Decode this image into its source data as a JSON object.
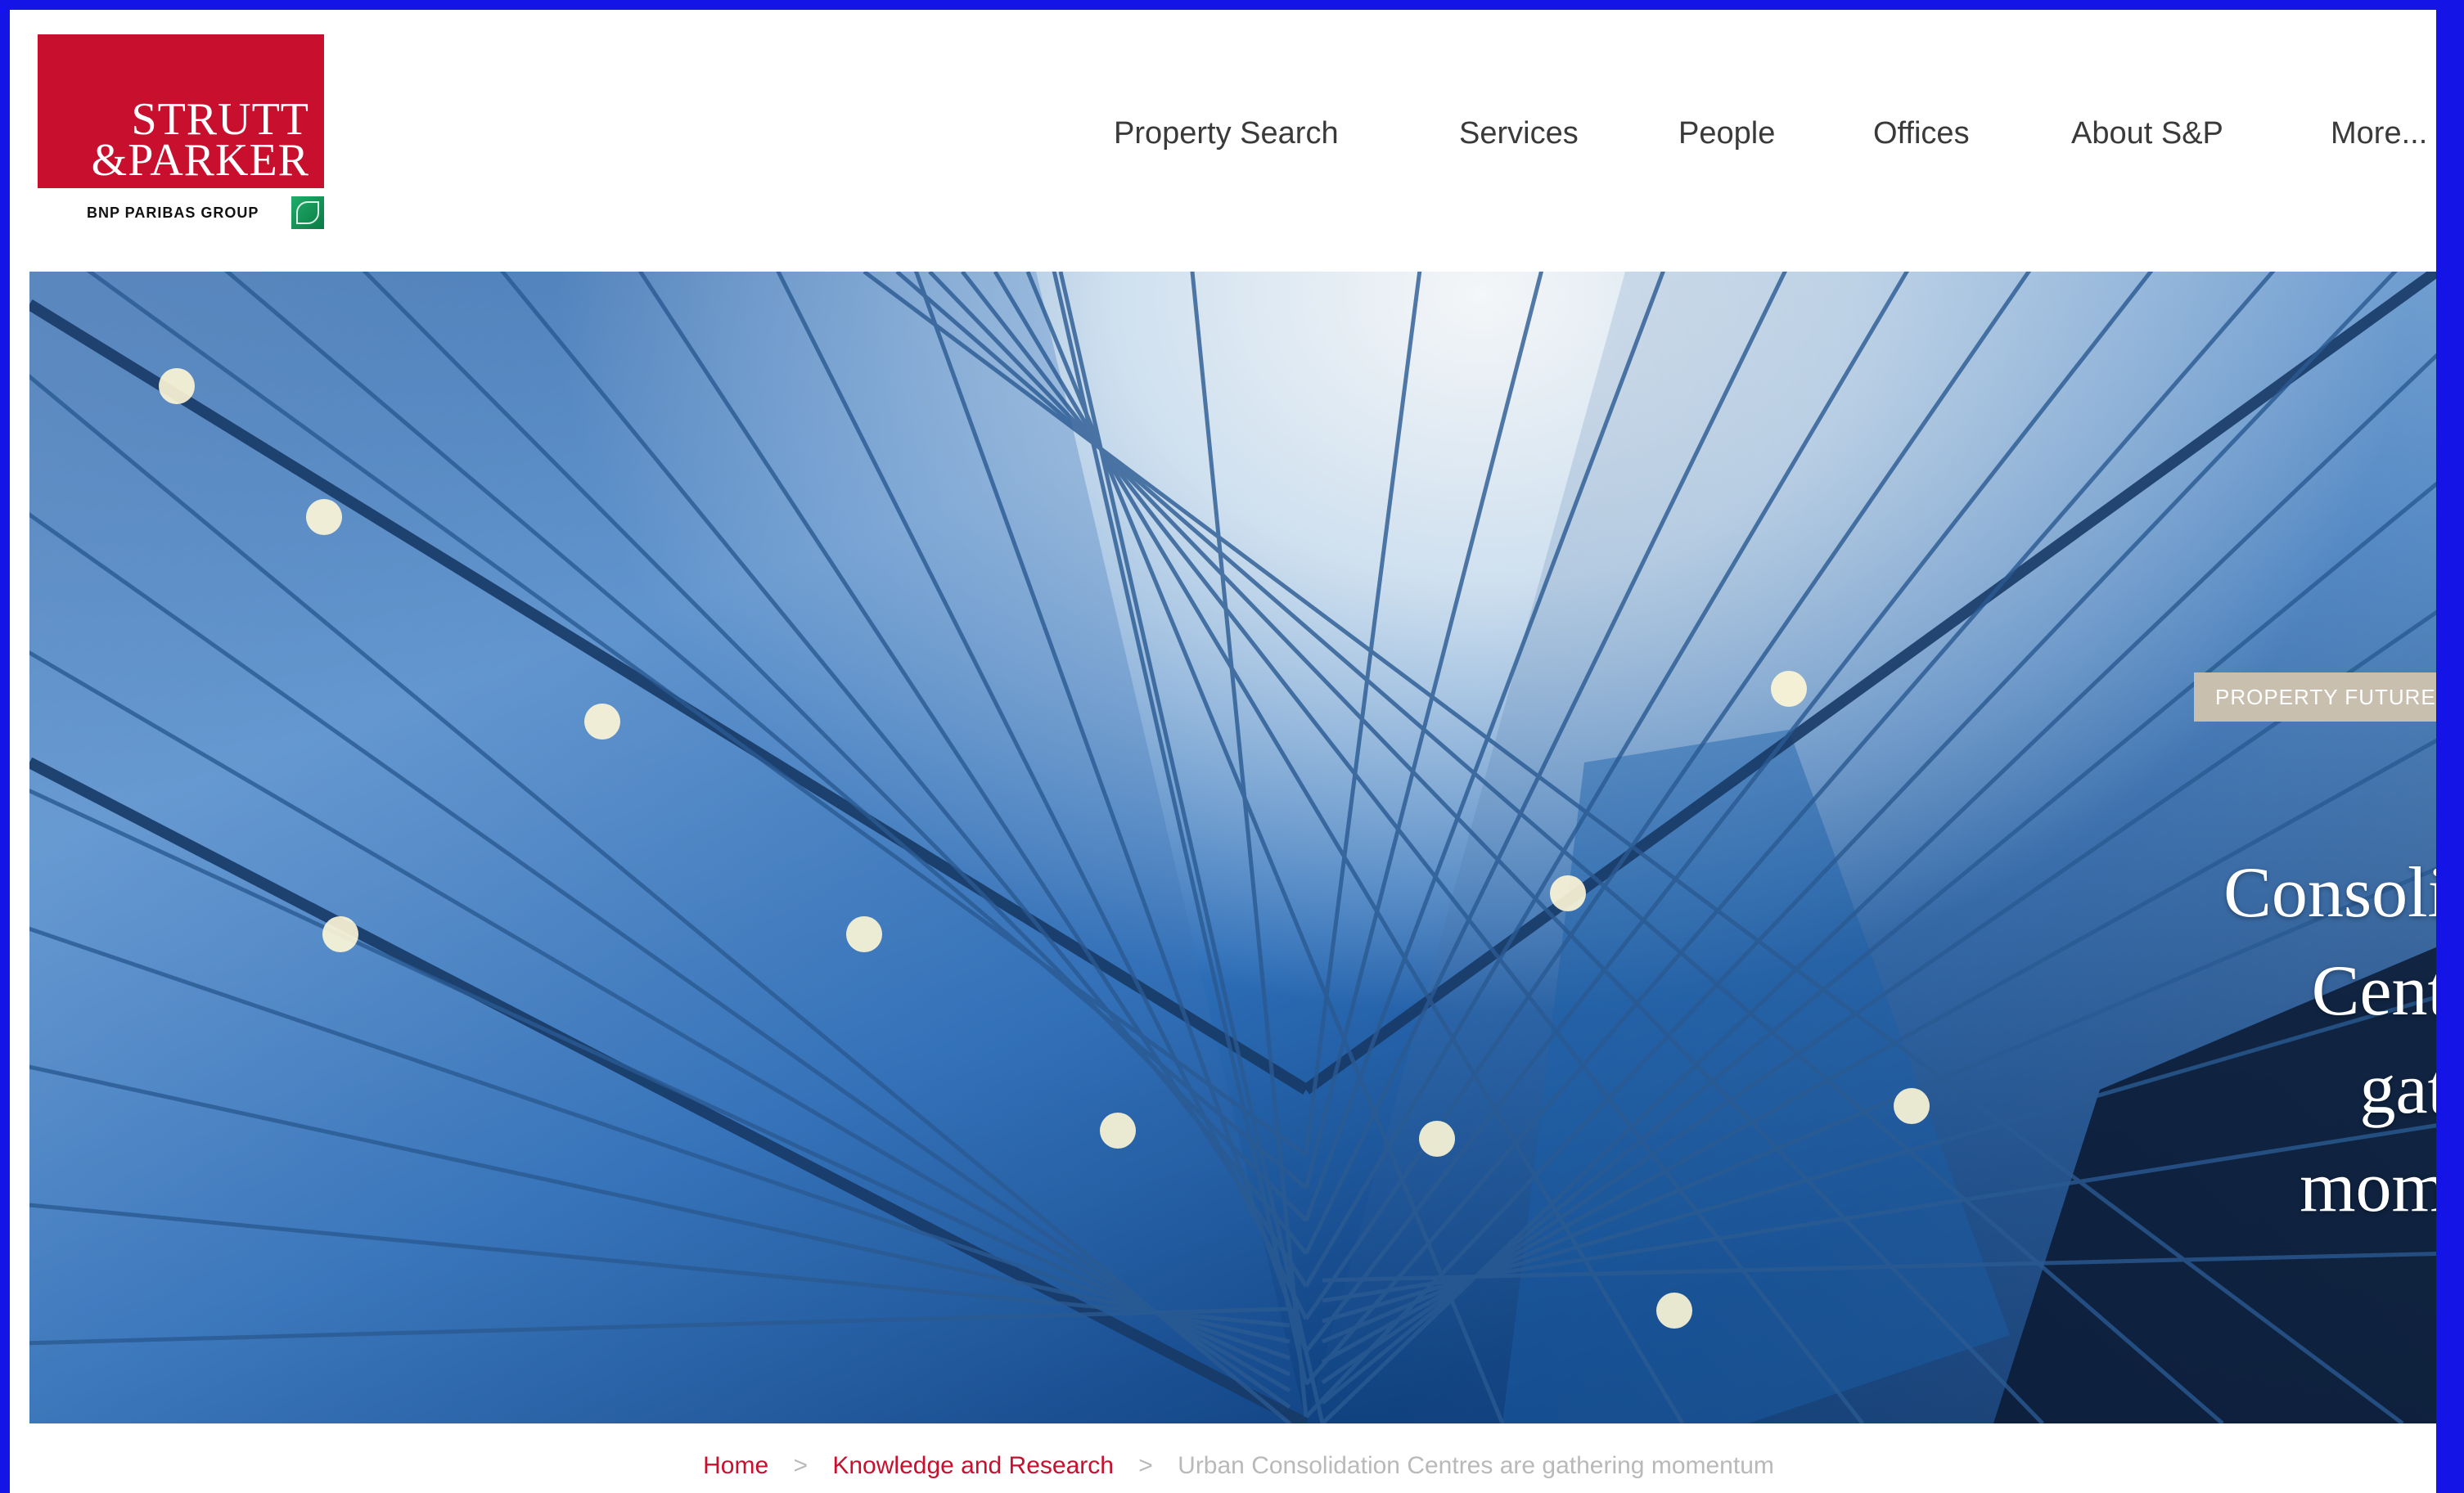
{
  "brand": {
    "line1": "STRUTT",
    "line2": "&PARKER",
    "sub": "BNP PARIBAS GROUP",
    "red": "#c8102e",
    "green": "#1fae6a"
  },
  "nav": {
    "items": [
      {
        "label": "Property Search"
      },
      {
        "label": "Services"
      },
      {
        "label": "People"
      },
      {
        "label": "Offices"
      },
      {
        "label": "About S&P"
      },
      {
        "label": "More..."
      }
    ]
  },
  "hero": {
    "tag": "PROPERTY FUTURE",
    "headline": [
      "Consoli",
      "Cent",
      "gat",
      "mom"
    ]
  },
  "breadcrumb": {
    "home": "Home",
    "section": "Knowledge and Research",
    "separator": ">",
    "current": "Urban Consolidation Centres are gathering momentum"
  }
}
